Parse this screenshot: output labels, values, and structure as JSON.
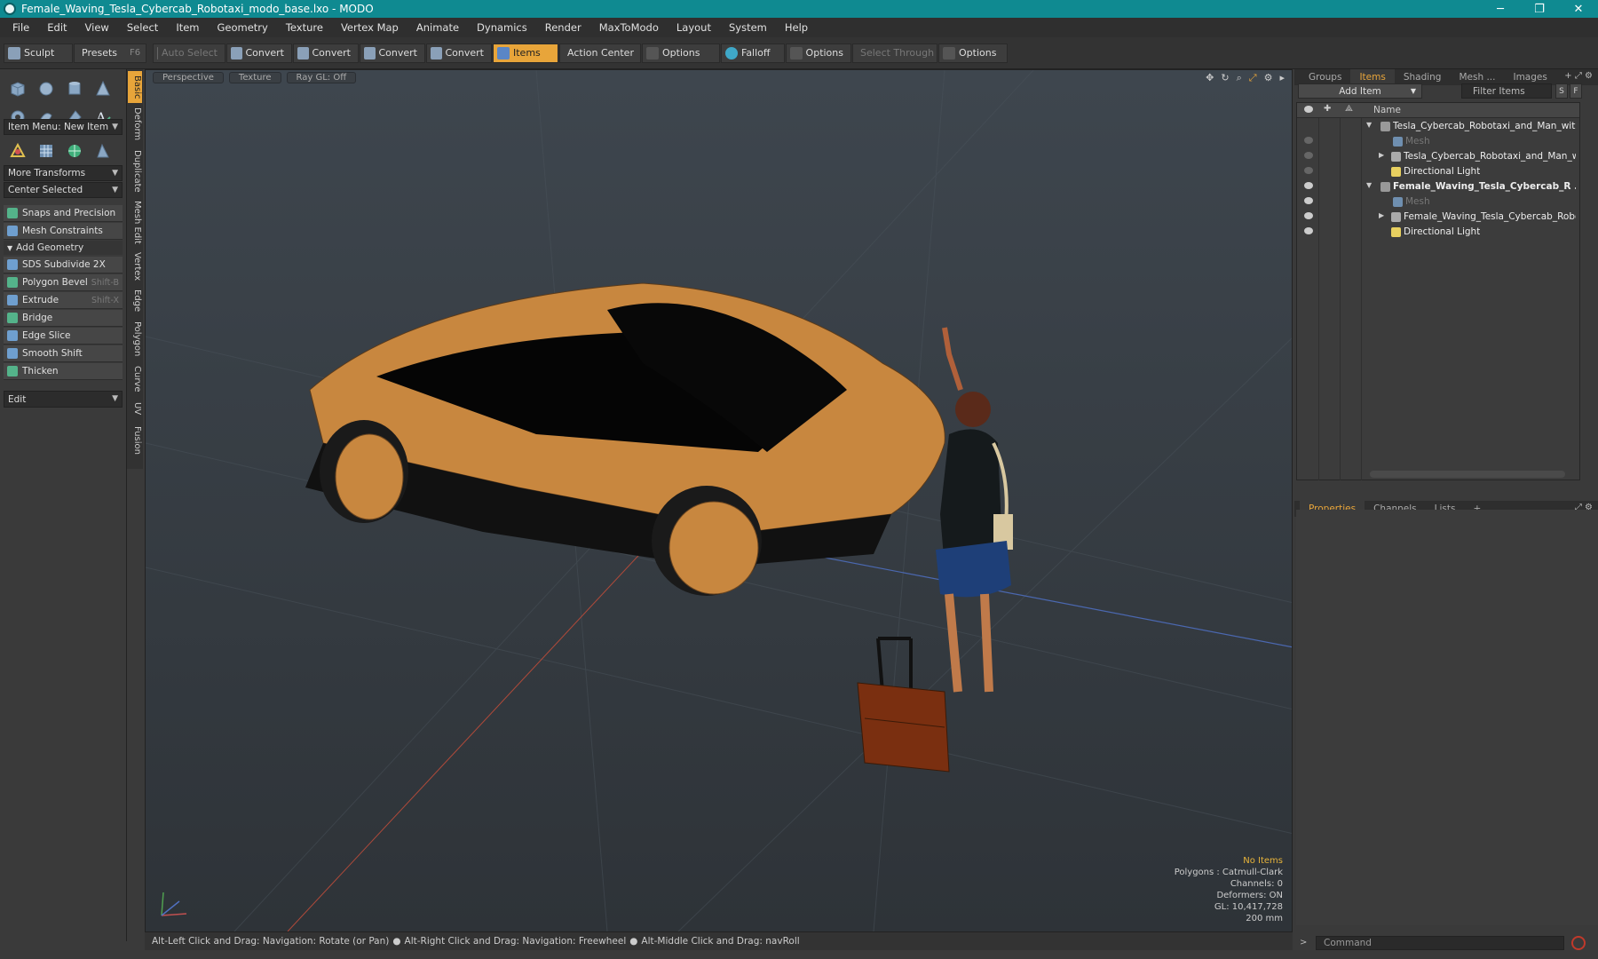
{
  "window": {
    "title": "Female_Waving_Tesla_Cybercab_Robotaxi_modo_base.lxo - MODO",
    "controls": [
      "─",
      "❐",
      "✕"
    ]
  },
  "menu": [
    "File",
    "Edit",
    "View",
    "Select",
    "Item",
    "Geometry",
    "Texture",
    "Vertex Map",
    "Animate",
    "Dynamics",
    "Render",
    "MaxToModo",
    "Layout",
    "System",
    "Help"
  ],
  "toolbar": {
    "sculpt": "Sculpt",
    "presets": "Presets",
    "presets_shortcut": "F6",
    "auto_select": "Auto Select",
    "convert1": "Convert",
    "convert2": "Convert",
    "convert3": "Convert",
    "convert4": "Convert",
    "items": "Items",
    "action_center": "Action Center",
    "options1": "Options",
    "falloff": "Falloff",
    "options2": "Options",
    "select_through": "Select Through",
    "options3": "Options"
  },
  "left_panel": {
    "item_menu": "Item Menu: New Item",
    "more_transforms": "More Transforms",
    "center_selected": "Center Selected",
    "snaps": "Snaps and Precision",
    "mesh_constraints": "Mesh Constraints",
    "add_geometry": "Add Geometry",
    "tools": [
      {
        "label": "SDS Subdivide 2X",
        "shortcut": ""
      },
      {
        "label": "Polygon Bevel",
        "shortcut": "Shift-B"
      },
      {
        "label": "Extrude",
        "shortcut": "Shift-X"
      },
      {
        "label": "Bridge",
        "shortcut": ""
      },
      {
        "label": "Edge Slice",
        "shortcut": ""
      },
      {
        "label": "Smooth Shift",
        "shortcut": ""
      },
      {
        "label": "Thicken",
        "shortcut": ""
      }
    ],
    "edit": "Edit"
  },
  "vertical_tabs": [
    "Basic",
    "Deform",
    "Duplicate",
    "Mesh Edit",
    "Vertex",
    "Edge",
    "Polygon",
    "Curve",
    "UV",
    "Fusion"
  ],
  "viewport": {
    "view": "Perspective",
    "shading": "Texture",
    "raygl": "Ray GL: Off",
    "hud": {
      "selection": "No Items",
      "polygons": "Polygons : Catmull-Clark",
      "channels": "Channels: 0",
      "deformers": "Deformers: ON",
      "gl": "GL: 10,417,728",
      "scale": "200 mm"
    }
  },
  "items_panel": {
    "tabs": [
      "Groups",
      "Items",
      "Shading",
      "Mesh ...",
      "Images"
    ],
    "active_tab": "Items",
    "add_item": "Add Item",
    "filter_items": "Filter Items",
    "s": "S",
    "f": "F",
    "name_header": "Name",
    "rows": [
      {
        "label": "Tesla_Cybercab_Robotaxi_and_Man_with_...",
        "kind": "scene"
      },
      {
        "label": "Mesh",
        "kind": "mesh"
      },
      {
        "label": "Tesla_Cybercab_Robotaxi_and_Man_wit...",
        "kind": "group"
      },
      {
        "label": "Directional Light",
        "kind": "light"
      },
      {
        "label": "Female_Waving_Tesla_Cybercab_R ...",
        "kind": "scene"
      },
      {
        "label": "Mesh",
        "kind": "mesh"
      },
      {
        "label": "Female_Waving_Tesla_Cybercab_Robot ...",
        "kind": "group"
      },
      {
        "label": "Directional Light",
        "kind": "light"
      }
    ]
  },
  "props_panel": {
    "tabs": [
      "Properties",
      "Channels",
      "Lists"
    ],
    "active_tab": "Properties"
  },
  "statusbar": {
    "hint1": "Alt-Left Click and Drag: Navigation: Rotate (or Pan)",
    "hint2": "Alt-Right Click and Drag: Navigation: Freewheel",
    "hint3": "Alt-Middle Click and Drag: navRoll",
    "bullet": "●"
  },
  "command": {
    "placeholder": "Command"
  }
}
